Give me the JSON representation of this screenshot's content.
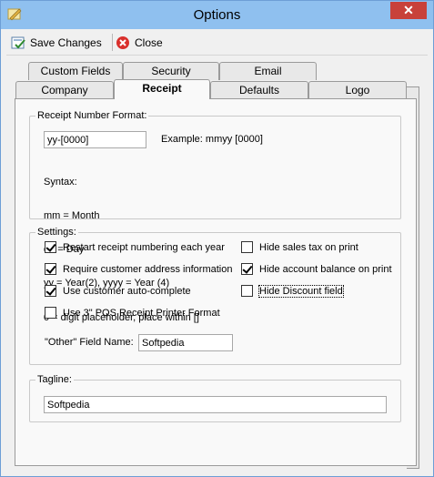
{
  "window": {
    "title": "Options",
    "close_glyph": "✕"
  },
  "toolbar": {
    "save_label": "Save Changes",
    "close_label": "Close"
  },
  "tabs": {
    "row1": [
      "Custom Fields",
      "Security",
      "Email"
    ],
    "row2": [
      "Company",
      "Receipt",
      "Defaults",
      "Logo"
    ],
    "active": "Receipt"
  },
  "receipt_number": {
    "legend": "Receipt Number Format:",
    "format_value": "yy-[0000]",
    "example_label": "Example:  mmyy [0000]",
    "syntax_lines": [
      "Syntax:",
      "mm = Month",
      "dd = Day",
      "yy = Year(2), yyyy = Year (4)",
      "0 = digit placeholder, place within []"
    ]
  },
  "settings": {
    "legend": "Settings:",
    "options": [
      {
        "label": "Restart receipt numbering each year",
        "checked": true
      },
      {
        "label": "Require customer address information",
        "checked": true
      },
      {
        "label": "Use customer auto-complete",
        "checked": true
      },
      {
        "label": "Use 3\" POS Receipt Printer Format",
        "checked": false
      },
      {
        "label": "Hide sales tax on print",
        "checked": false
      },
      {
        "label": "Hide account balance on print",
        "checked": true
      },
      {
        "label": "Hide Discount field",
        "checked": false
      }
    ],
    "other_field_label": "\"Other\" Field Name:",
    "other_field_value": "Softpedia"
  },
  "tagline": {
    "legend": "Tagline:",
    "value": "Softpedia"
  },
  "colors": {
    "titlebar": "#8fc0ef",
    "close": "#c8413a",
    "panel": "#f9f9f9"
  }
}
